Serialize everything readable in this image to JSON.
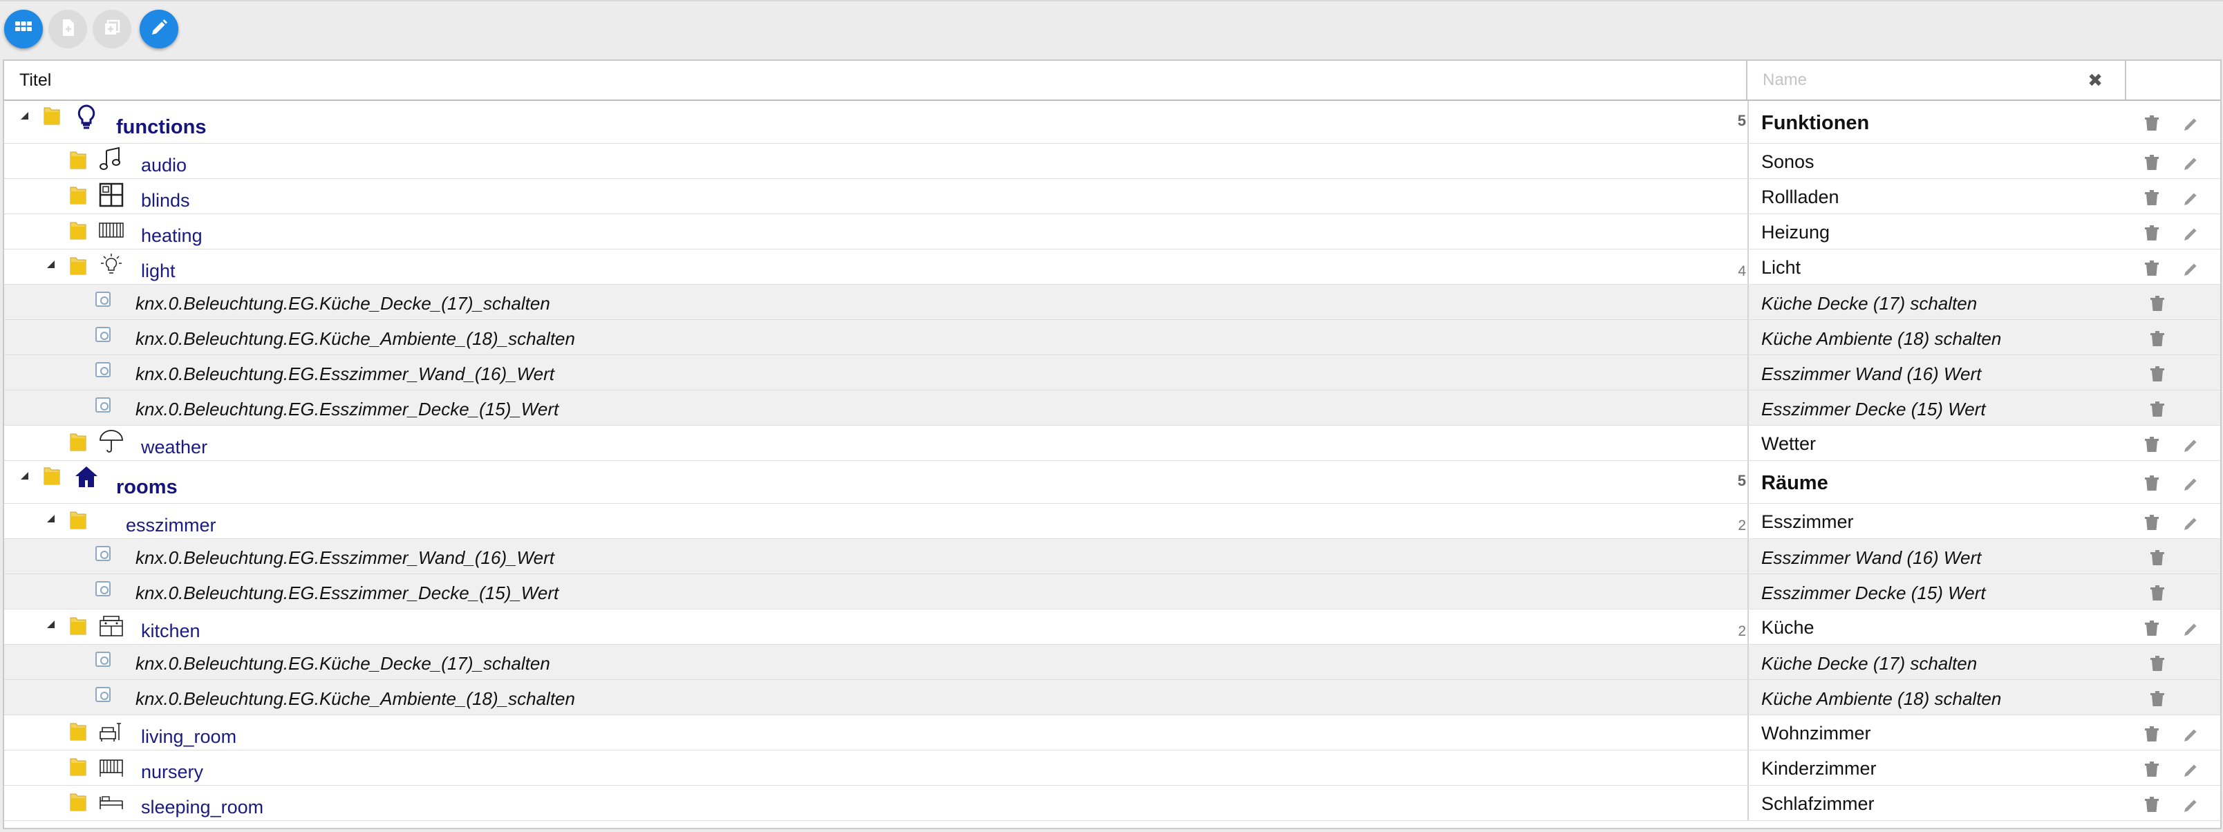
{
  "toolbar": {
    "buttons": [
      {
        "name": "grid-view-button",
        "icon": "grid-icon",
        "state": "active"
      },
      {
        "name": "add-state-button",
        "icon": "file-add-icon",
        "state": "disabled"
      },
      {
        "name": "add-folder-button",
        "icon": "square-plus-icon",
        "state": "disabled"
      },
      {
        "name": "edit-mode-button",
        "icon": "pencil-icon",
        "state": "active"
      }
    ]
  },
  "table": {
    "header": {
      "title": "Titel",
      "name_placeholder": "Name",
      "clear": "✖"
    },
    "rows": [
      {
        "label": "functions",
        "name": "Funktionen",
        "count": "5",
        "kind": "root",
        "icon": "lightbulb-icon"
      },
      {
        "label": "audio",
        "name": "Sonos",
        "count": "",
        "kind": "folder",
        "icon": "music-note-icon"
      },
      {
        "label": "blinds",
        "name": "Rollladen",
        "count": "",
        "kind": "folder",
        "icon": "window-icon"
      },
      {
        "label": "heating",
        "name": "Heizung",
        "count": "",
        "kind": "folder",
        "icon": "radiator-icon"
      },
      {
        "label": "light",
        "name": "Licht",
        "count": "4",
        "kind": "folder-open",
        "icon": "light-bulb-rays-icon"
      },
      {
        "label": "knx.0.Beleuchtung.EG.Küche_Decke_(17)_schalten",
        "name": "Küche Decke (17) schalten",
        "kind": "state"
      },
      {
        "label": "knx.0.Beleuchtung.EG.Küche_Ambiente_(18)_schalten",
        "name": "Küche Ambiente (18) schalten",
        "kind": "state"
      },
      {
        "label": "knx.0.Beleuchtung.EG.Esszimmer_Wand_(16)_Wert",
        "name": "Esszimmer Wand (16) Wert",
        "kind": "state"
      },
      {
        "label": "knx.0.Beleuchtung.EG.Esszimmer_Decke_(15)_Wert",
        "name": "Esszimmer Decke (15) Wert",
        "kind": "state"
      },
      {
        "label": "weather",
        "name": "Wetter",
        "count": "",
        "kind": "folder",
        "icon": "umbrella-icon"
      },
      {
        "label": "rooms",
        "name": "Räume",
        "count": "5",
        "kind": "root",
        "icon": "house-icon"
      },
      {
        "label": "esszimmer",
        "name": "Esszimmer",
        "count": "2",
        "kind": "folder-open",
        "icon": ""
      },
      {
        "label": "knx.0.Beleuchtung.EG.Esszimmer_Wand_(16)_Wert",
        "name": "Esszimmer Wand (16) Wert",
        "kind": "state"
      },
      {
        "label": "knx.0.Beleuchtung.EG.Esszimmer_Decke_(15)_Wert",
        "name": "Esszimmer Decke (15) Wert",
        "kind": "state"
      },
      {
        "label": "kitchen",
        "name": "Küche",
        "count": "2",
        "kind": "folder-open",
        "icon": "kitchen-icon"
      },
      {
        "label": "knx.0.Beleuchtung.EG.Küche_Decke_(17)_schalten",
        "name": "Küche Decke (17) schalten",
        "kind": "state"
      },
      {
        "label": "knx.0.Beleuchtung.EG.Küche_Ambiente_(18)_schalten",
        "name": "Küche Ambiente (18) schalten",
        "kind": "state"
      },
      {
        "label": "living_room",
        "name": "Wohnzimmer",
        "count": "",
        "kind": "folder",
        "icon": "living-room-icon"
      },
      {
        "label": "nursery",
        "name": "Kinderzimmer",
        "count": "",
        "kind": "folder",
        "icon": "crib-icon"
      },
      {
        "label": "sleeping_room",
        "name": "Schlafzimmer",
        "count": "",
        "kind": "folder",
        "icon": "bed-icon"
      }
    ]
  },
  "colors": {
    "accent": "#1e88e5",
    "link": "#1a1a80",
    "folder": "#f0c419"
  }
}
